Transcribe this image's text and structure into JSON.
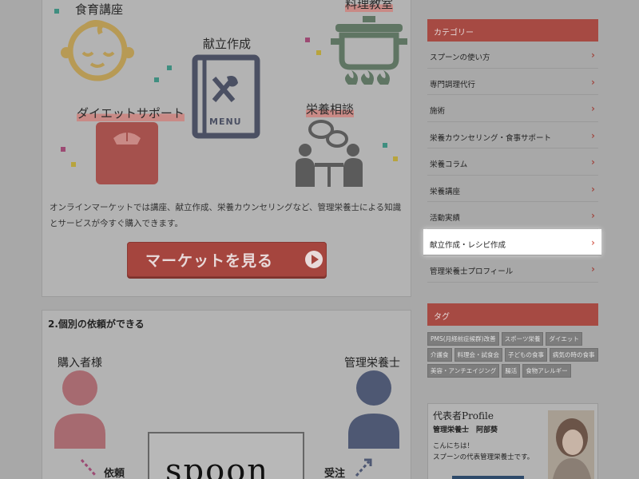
{
  "services": {
    "food_course": "食育講座",
    "cooking_class": "料理教室",
    "menu_planning": "献立作成",
    "diet_support": "ダイエットサポート",
    "nutrition_consult": "栄養相談",
    "menu_word": "MENU"
  },
  "description": "オンラインマーケットでは講座、献立作成、栄養カウンセリングなど、管理栄養士による知識とサービスが今すぐ購入できます。",
  "market_button": "マーケットを見る",
  "section2": {
    "title": "2.個別の依頼ができる",
    "buyer": "購入者様",
    "dietitian": "管理栄養士",
    "request": "依頼",
    "accept": "受注",
    "logo_text": "spoon"
  },
  "sidebar": {
    "category_heading": "カテゴリー",
    "categories": [
      "スプーンの使い方",
      "専門調理代行",
      "施術",
      "栄養カウンセリング・食事サポート",
      "栄養コラム",
      "栄養講座",
      "活動実績",
      "献立作成・レシピ作成",
      "管理栄養士プロフィール"
    ],
    "active_index": 7,
    "tag_heading": "タグ",
    "tags": [
      "PMS(月経前症候群)改善",
      "スポーツ栄養",
      "ダイエット",
      "介護食",
      "料理会・試食会",
      "子どもの食事",
      "病気の時の食事",
      "美容・アンチエイジング",
      "腸活",
      "食物アレルギー"
    ],
    "profile": {
      "title": "代表者Profile",
      "name": "管理栄養士　阿部葵",
      "line1": "こんにちは！",
      "line2": "スプーンの代表管理栄養士です。"
    }
  },
  "colors": {
    "accent": "#a64a43",
    "overlay_bg": "#a8a8a8",
    "icon_gold": "#b79a55",
    "icon_navy": "#4b5063",
    "icon_green": "#5f7563",
    "icon_red": "#a5514d"
  }
}
